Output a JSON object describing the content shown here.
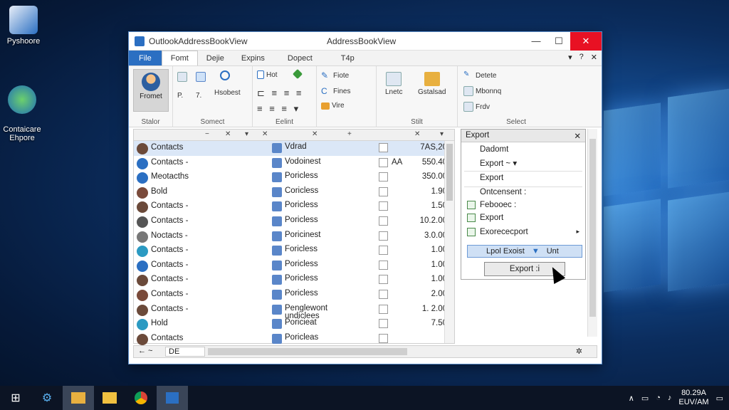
{
  "desktop": {
    "icons": [
      {
        "label": "Pyshoore"
      },
      {
        "label": "Contaicare\nEhpore"
      }
    ]
  },
  "window": {
    "title_left": "OutlookAddressBookView",
    "title_center": "AddressBookView",
    "controls": {
      "minimize": "—",
      "maximize": "☐",
      "close": "✕"
    }
  },
  "tabs": [
    {
      "label": "File"
    },
    {
      "label": "Fomt"
    },
    {
      "label": "Dejie"
    },
    {
      "label": "Expins"
    },
    {
      "label": "Dopect"
    },
    {
      "label": "T4p"
    }
  ],
  "tabs_right": {
    "dropdown": "▾",
    "help": "?",
    "pin": "✕"
  },
  "ribbon": {
    "groups": [
      {
        "label": "Stalor",
        "big_button": "Fromet"
      },
      {
        "label": "Somect",
        "buttons": [
          "P.",
          "7.",
          "Hsobest"
        ]
      },
      {
        "label": "Eelint",
        "buttons": [
          "Hot"
        ]
      },
      {
        "label": "",
        "buttons": [
          "Fiote",
          "Fines",
          "Vire"
        ]
      },
      {
        "label": "Stilt",
        "buttons": [
          "Lnetc",
          "Gstalsad"
        ]
      },
      {
        "label": "Select",
        "buttons": [
          "Detete",
          "Mbonnq",
          "Frdv"
        ]
      }
    ]
  },
  "list": {
    "header_value": "7AS,20",
    "header_ext": "A",
    "rows": [
      {
        "name": "Contacts",
        "type": "Vdrad",
        "extra": "",
        "value": "7AS,20"
      },
      {
        "name": "Contacts -",
        "type": "Vodoinest",
        "extra": "AA",
        "value": "550.40"
      },
      {
        "name": "Meotacths",
        "type": "Poricless",
        "extra": "",
        "value": "350.00"
      },
      {
        "name": "Bold",
        "type": "Coricless",
        "extra": "",
        "value": "1.90"
      },
      {
        "name": "Contacts -",
        "type": "Poricless",
        "extra": "",
        "value": "1.50"
      },
      {
        "name": "Contacts -",
        "type": "Poricless",
        "extra": "",
        "value": "10.2.00"
      },
      {
        "name": "Noctacts -",
        "type": "Poricinest",
        "extra": "",
        "value": "3.0.00"
      },
      {
        "name": "Contacts -",
        "type": "Foricless",
        "extra": "",
        "value": "1.00"
      },
      {
        "name": "Contacts -",
        "type": "Poricless",
        "extra": "",
        "value": "1.00"
      },
      {
        "name": "Contacts -",
        "type": "Poricless",
        "extra": "",
        "value": "1.00"
      },
      {
        "name": "Contacts -",
        "type": "Poricless",
        "extra": "",
        "value": "2.00"
      },
      {
        "name": "Contacts -",
        "type": "Penglewont\nundiclees",
        "extra": "",
        "value": "1. 2.00"
      },
      {
        "name": "Hold",
        "type": "Poricieat",
        "extra": "",
        "value": "7.50"
      },
      {
        "name": "Contacts",
        "type": "Poricleas",
        "extra": "",
        "value": ""
      }
    ],
    "bottom_field": "DE"
  },
  "export_panel": {
    "title": "Export",
    "items": [
      "Dadomt",
      "Export ~",
      "Export",
      "Ontcensent :",
      "Febooec :",
      "Export",
      "Exorececport"
    ],
    "field_left": "Lpol Exoist",
    "field_right": "Unt",
    "button": "Export :i"
  },
  "taskbar": {
    "clock_time": "80.29A",
    "clock_date": "EUV/AM"
  }
}
